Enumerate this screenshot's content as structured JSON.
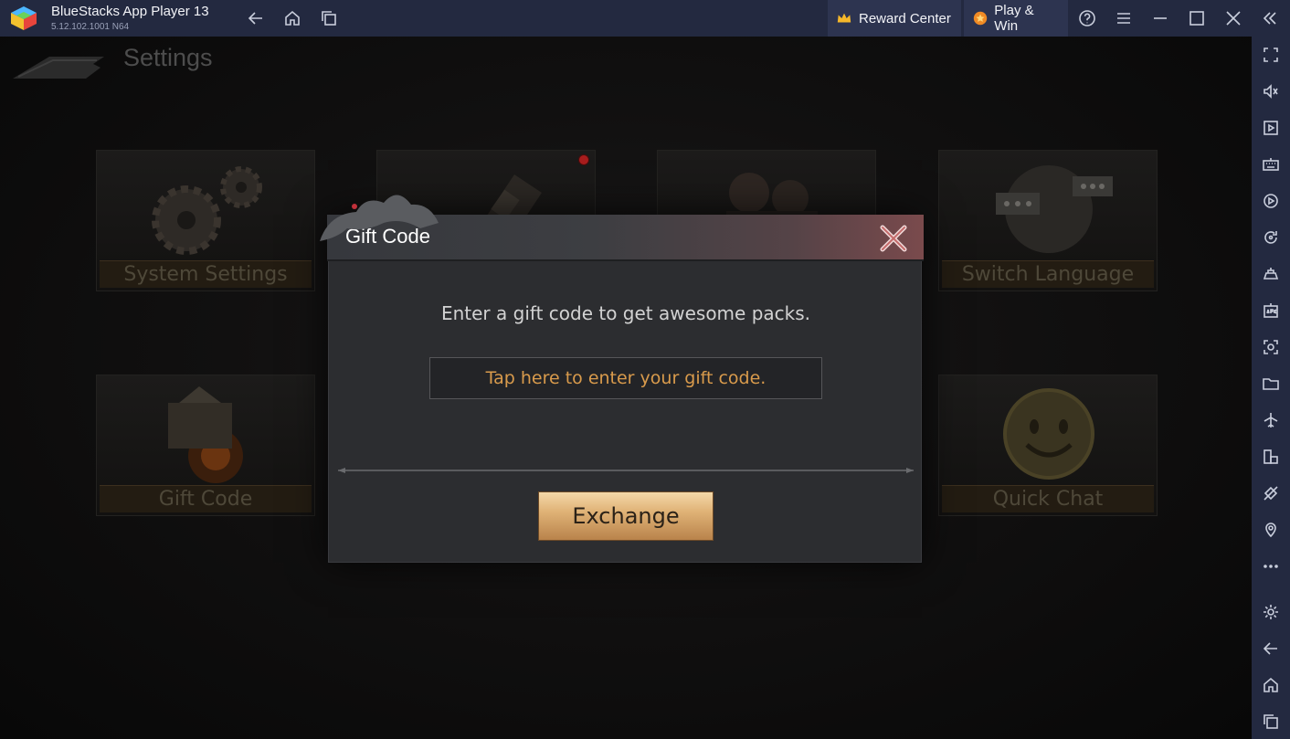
{
  "window": {
    "app_title": "BlueStacks App Player 13",
    "app_version": "5.12.102.1001  N64"
  },
  "titlebar": {
    "nav_icons": [
      "back-icon",
      "home-icon",
      "recent-apps-icon"
    ],
    "reward_center_label": "Reward Center",
    "play_win_label": "Play & Win",
    "control_icons": [
      "help-icon",
      "menu-icon",
      "minimize-icon",
      "maximize-icon",
      "close-icon",
      "collapse-sidebar-icon"
    ]
  },
  "sidebar": {
    "icons": [
      "fullscreen-icon",
      "volume-icon",
      "media-icon",
      "keyboard-icon",
      "record-icon",
      "rotate-icon",
      "controller-icon",
      "apk-icon",
      "screenshot-icon",
      "folder-icon",
      "airplane-icon",
      "multi-instance-icon",
      "eco-mode-icon",
      "location-icon",
      "more-icon",
      "settings-icon",
      "back-icon",
      "home-icon",
      "recent-apps-icon"
    ]
  },
  "game": {
    "header_title": "Settings",
    "tiles": [
      {
        "label": "System Settings"
      },
      {
        "label": ""
      },
      {
        "label": ""
      },
      {
        "label": "Switch Language"
      },
      {
        "label": "Gift Code"
      },
      {
        "label": "Quick Chat"
      }
    ]
  },
  "dialog": {
    "title": "Gift Code",
    "message": "Enter a gift code to get awesome packs.",
    "input_placeholder": "Tap here to enter your gift code.",
    "button_label": "Exchange"
  },
  "colors": {
    "titlebar_bg": "#232940",
    "dialog_bg": "#2c2d30",
    "input_text": "#d99b4c",
    "button_gold": "#e0b377"
  }
}
